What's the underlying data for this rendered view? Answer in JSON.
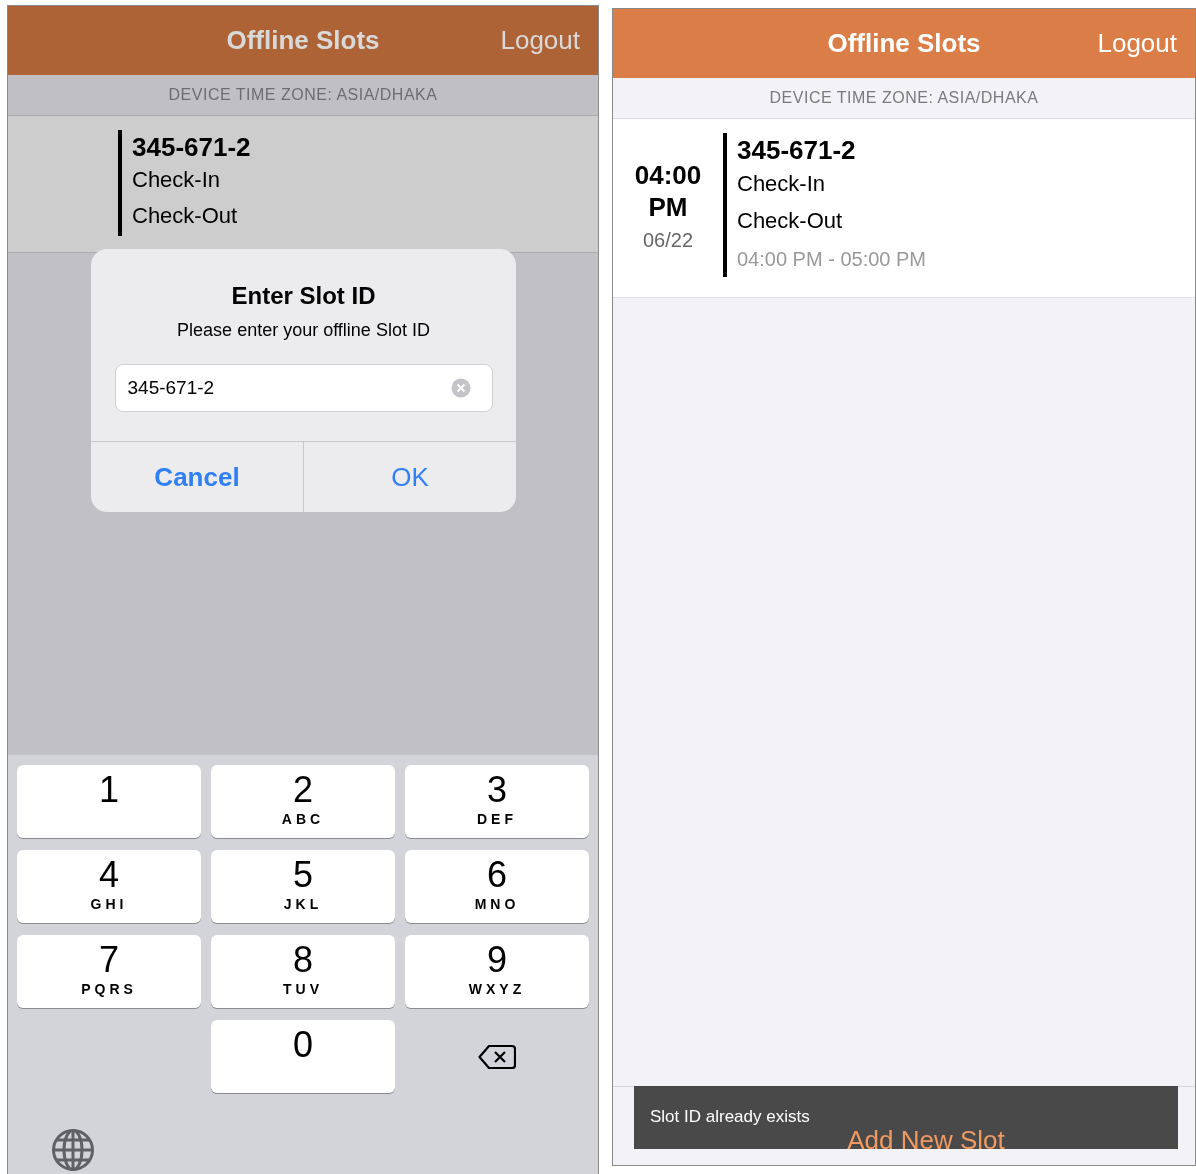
{
  "screens": [
    {
      "dimmed": true,
      "header": {
        "title": "Offline Slots",
        "action": "Logout"
      },
      "timezone": "DEVICE TIME ZONE: ASIA/DHAKA",
      "slots": [
        {
          "id": "345-671-2",
          "check_in": "Check-In",
          "check_out": "Check-Out"
        }
      ],
      "dialog": {
        "title": "Enter Slot ID",
        "message": "Please enter your offline Slot ID",
        "field": {
          "value": "345-671-2"
        },
        "buttons": [
          {
            "label": "Cancel",
            "bold": true
          },
          {
            "label": "OK",
            "bold": false
          }
        ]
      },
      "keyboard": {
        "keys": [
          {
            "kind": "digit",
            "digit": "1"
          },
          {
            "kind": "digit",
            "digit": "2",
            "letters": "ABC"
          },
          {
            "kind": "digit",
            "digit": "3",
            "letters": "DEF"
          },
          {
            "kind": "digit",
            "digit": "4",
            "letters": "GHI"
          },
          {
            "kind": "digit",
            "digit": "5",
            "letters": "JKL"
          },
          {
            "kind": "digit",
            "digit": "6",
            "letters": "MNO"
          },
          {
            "kind": "digit",
            "digit": "7",
            "letters": "PQRS"
          },
          {
            "kind": "digit",
            "digit": "8",
            "letters": "TUV"
          },
          {
            "kind": "digit",
            "digit": "9",
            "letters": "WXYZ"
          },
          {
            "kind": "blank"
          },
          {
            "kind": "digit",
            "digit": "0"
          },
          {
            "kind": "delete"
          }
        ]
      }
    },
    {
      "dimmed": false,
      "header": {
        "title": "Offline Slots",
        "action": "Logout"
      },
      "timezone": "DEVICE TIME ZONE: ASIA/DHAKA",
      "slots": [
        {
          "time": "04:00",
          "period": "PM",
          "date": "06/22",
          "id": "345-671-2",
          "check_in": "Check-In",
          "check_out": "Check-Out",
          "range": "04:00 PM - 05:00 PM"
        }
      ],
      "footer": {
        "button": "Add New Slot"
      },
      "toast": {
        "message": "Slot ID already exists"
      }
    }
  ]
}
